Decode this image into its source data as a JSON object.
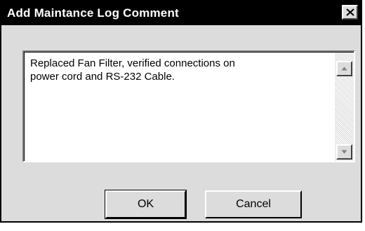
{
  "dialog": {
    "title": "Add Maintance Log Comment",
    "close_icon": "close-x-icon"
  },
  "comment": {
    "value": "Replaced Fan Filter, verified connections on\npower cord and RS-232 Cable."
  },
  "scrollbar": {
    "up_icon": "scroll-up-arrow-icon",
    "down_icon": "scroll-down-arrow-icon"
  },
  "buttons": {
    "ok_label": "OK",
    "cancel_label": "Cancel"
  },
  "colors": {
    "titlebar": "#000000",
    "face": "#dcdcdc",
    "field": "#ffffff"
  }
}
